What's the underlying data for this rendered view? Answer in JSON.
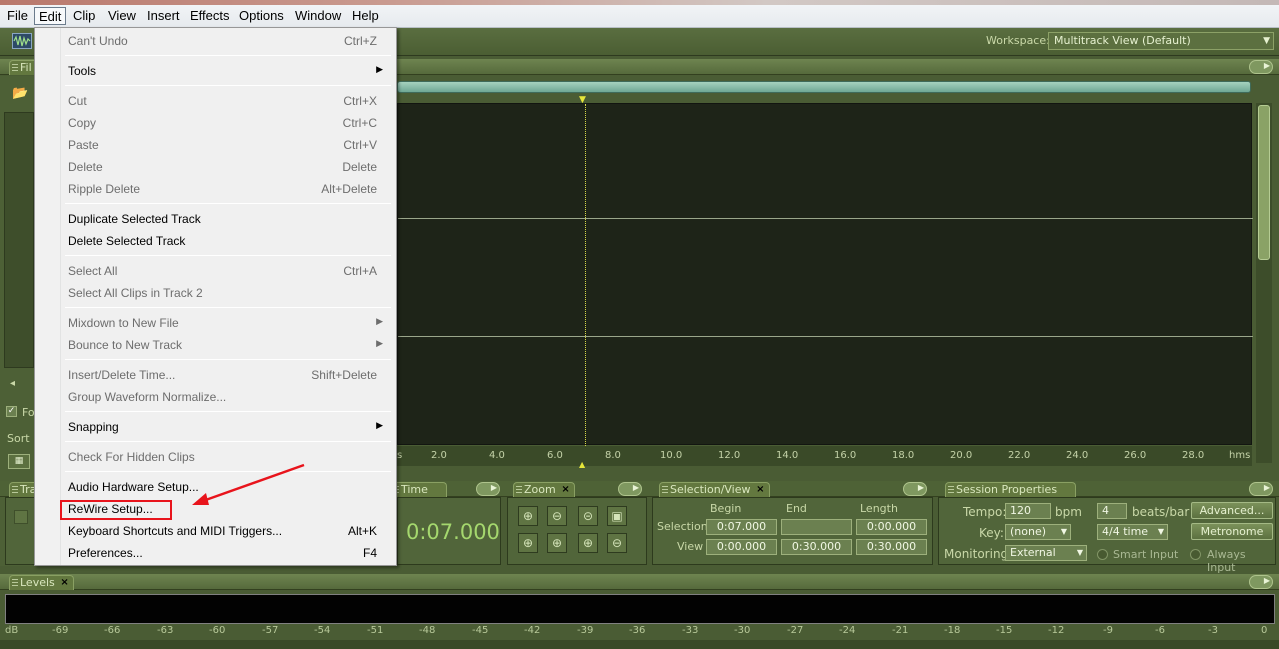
{
  "menubar": {
    "items": [
      "File",
      "Edit",
      "Clip",
      "View",
      "Insert",
      "Effects",
      "Options",
      "Window",
      "Help"
    ]
  },
  "toolbar": {
    "workspace_label": "Workspace:",
    "workspace_value": "Multitrack View (Default)"
  },
  "panels": {
    "files_tab": "Fil",
    "transport_tab": "Tra",
    "time_tab": "Time",
    "zoom_tab": "Zoom",
    "selection_tab": "Selection/View",
    "session_tab": "Session Properties",
    "levels_tab": "Levels",
    "sort_label": "Sort",
    "fo_label": "Fo"
  },
  "time_display": "0:07.000",
  "ruler": {
    "unit": "hms",
    "ticks": [
      "s",
      "2.0",
      "4.0",
      "6.0",
      "8.0",
      "10.0",
      "12.0",
      "14.0",
      "16.0",
      "18.0",
      "20.0",
      "22.0",
      "24.0",
      "26.0",
      "28.0"
    ]
  },
  "selection_view": {
    "headers": [
      "Begin",
      "End",
      "Length"
    ],
    "selection_label": "Selection",
    "view_label": "View",
    "selection": [
      "0:07.000",
      "",
      "0:00.000"
    ],
    "view": [
      "0:00.000",
      "0:30.000",
      "0:30.000"
    ]
  },
  "session": {
    "tempo_label": "Tempo:",
    "tempo": "120",
    "bpm": "bpm",
    "beats": "4",
    "beats_label": "beats/bar",
    "advanced": "Advanced...",
    "key_label": "Key:",
    "key": "(none)",
    "time_sig": "4/4 time",
    "metronome": "Metronome",
    "monitoring_label": "Monitoring:",
    "monitoring": "External",
    "smart_input": "Smart Input",
    "always_input": "Always Input"
  },
  "levels": {
    "scale": [
      "dB",
      "-69",
      "-66",
      "-63",
      "-60",
      "-57",
      "-54",
      "-51",
      "-48",
      "-45",
      "-42",
      "-39",
      "-36",
      "-33",
      "-30",
      "-27",
      "-24",
      "-21",
      "-18",
      "-15",
      "-12",
      "-9",
      "-6",
      "-3",
      "0"
    ]
  },
  "edit_menu": {
    "items": [
      {
        "label": "Can't Undo",
        "shortcut": "Ctrl+Z",
        "disabled": true
      },
      {
        "label": "Tools",
        "submenu": true
      },
      {
        "label": "Cut",
        "shortcut": "Ctrl+X",
        "disabled": true
      },
      {
        "label": "Copy",
        "shortcut": "Ctrl+C",
        "disabled": true
      },
      {
        "label": "Paste",
        "shortcut": "Ctrl+V",
        "disabled": true
      },
      {
        "label": "Delete",
        "shortcut": "Delete",
        "disabled": true
      },
      {
        "label": "Ripple Delete",
        "shortcut": "Alt+Delete",
        "disabled": true
      },
      {
        "label": "Duplicate Selected Track"
      },
      {
        "label": "Delete Selected Track"
      },
      {
        "label": "Select All",
        "shortcut": "Ctrl+A",
        "disabled": true
      },
      {
        "label": "Select All Clips in Track 2",
        "disabled": true
      },
      {
        "label": "Mixdown to New File",
        "submenu": true,
        "disabled": true
      },
      {
        "label": "Bounce to New Track",
        "submenu": true,
        "disabled": true
      },
      {
        "label": "Insert/Delete Time...",
        "shortcut": "Shift+Delete",
        "disabled": true
      },
      {
        "label": "Group Waveform Normalize...",
        "disabled": true
      },
      {
        "label": "Snapping",
        "submenu": true
      },
      {
        "label": "Check For Hidden Clips",
        "disabled": true
      },
      {
        "label": "Audio Hardware Setup..."
      },
      {
        "label": "ReWire Setup..."
      },
      {
        "label": "Keyboard Shortcuts and MIDI Triggers...",
        "shortcut": "Alt+K"
      },
      {
        "label": "Preferences...",
        "shortcut": "F4"
      }
    ]
  }
}
